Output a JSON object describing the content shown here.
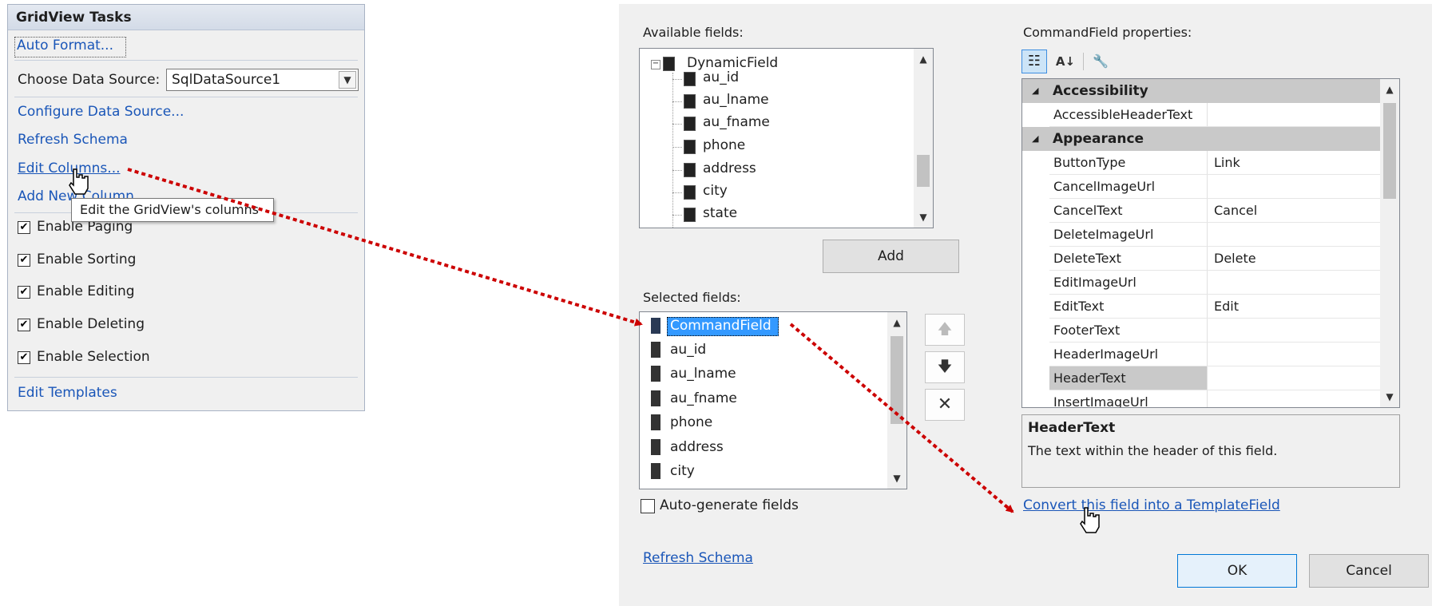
{
  "tasks_panel": {
    "title": "GridView Tasks",
    "auto_format": "Auto Format...",
    "choose_data_source_label": "Choose Data Source:",
    "data_source_value": "SqlDataSource1",
    "configure_data_source": "Configure Data Source...",
    "refresh_schema": "Refresh Schema",
    "edit_columns": "Edit Columns...",
    "add_new_column": "Add New Column...",
    "tooltip": "Edit the GridView's columns",
    "checkboxes": [
      {
        "label": "Enable Paging",
        "checked": true
      },
      {
        "label": "Enable Sorting",
        "checked": true
      },
      {
        "label": "Enable Editing",
        "checked": true
      },
      {
        "label": "Enable Deleting",
        "checked": true
      },
      {
        "label": "Enable Selection",
        "checked": true
      }
    ],
    "edit_templates": "Edit Templates",
    "check_mark": "✔"
  },
  "dialog": {
    "available_fields_label": "Available fields:",
    "tree_root": "DynamicField",
    "tree_items": [
      "au_id",
      "au_lname",
      "au_fname",
      "phone",
      "address",
      "city",
      "state"
    ],
    "add_button": "Add",
    "selected_fields_label": "Selected fields:",
    "selected_fields": [
      "CommandField",
      "au_id",
      "au_lname",
      "au_fname",
      "phone",
      "address",
      "city"
    ],
    "auto_generate_label": "Auto-generate fields",
    "auto_generate_checked": false,
    "refresh_schema": "Refresh Schema",
    "properties_label": "CommandField properties:",
    "categories": [
      {
        "name": "Accessibility",
        "rows": [
          {
            "name": "AccessibleHeaderText",
            "value": ""
          }
        ]
      },
      {
        "name": "Appearance",
        "rows": [
          {
            "name": "ButtonType",
            "value": "Link"
          },
          {
            "name": "CancelImageUrl",
            "value": ""
          },
          {
            "name": "CancelText",
            "value": "Cancel"
          },
          {
            "name": "DeleteImageUrl",
            "value": ""
          },
          {
            "name": "DeleteText",
            "value": "Delete"
          },
          {
            "name": "EditImageUrl",
            "value": ""
          },
          {
            "name": "EditText",
            "value": "Edit"
          },
          {
            "name": "FooterText",
            "value": ""
          },
          {
            "name": "HeaderImageUrl",
            "value": ""
          },
          {
            "name": "HeaderText",
            "value": ""
          },
          {
            "name": "InsertImageUrl",
            "value": ""
          }
        ]
      }
    ],
    "description_title": "HeaderText",
    "description_text": "The text within the header of this field.",
    "convert_link": "Convert this field into a TemplateField",
    "ok_button": "OK",
    "cancel_button": "Cancel"
  },
  "colors": {
    "link": "#1a56b8",
    "arrow": "#cc0000",
    "selection": "#3399ff"
  }
}
